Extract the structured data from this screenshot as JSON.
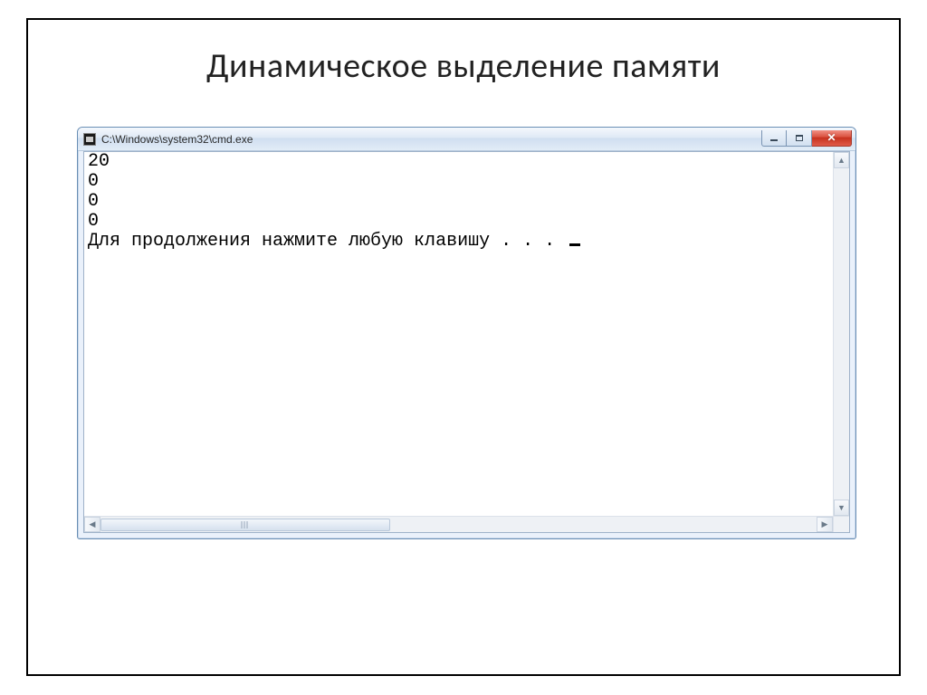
{
  "slide": {
    "title": "Динамическое выделение памяти"
  },
  "window": {
    "title": "C:\\Windows\\system32\\cmd.exe"
  },
  "console": {
    "lines": [
      "20",
      "0",
      "0",
      "0"
    ],
    "prompt": "Для продолжения нажмите любую клавишу . . . "
  }
}
